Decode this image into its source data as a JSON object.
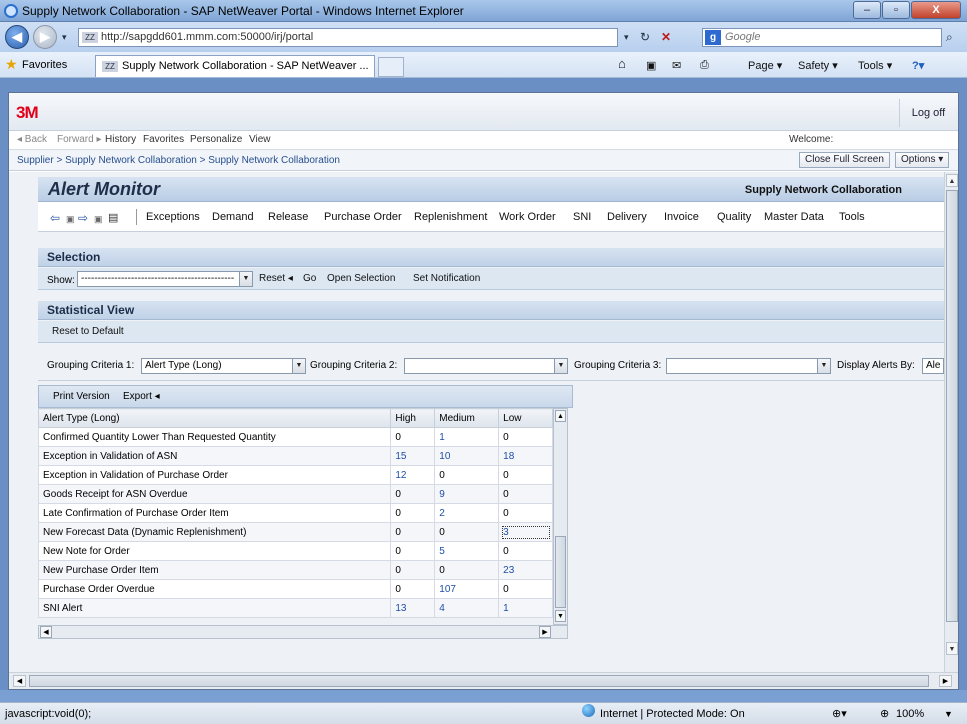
{
  "window": {
    "title": "Supply Network Collaboration - SAP NetWeaver Portal - Windows Internet Explorer",
    "minimize": "–",
    "maximize": "▫",
    "close": "X"
  },
  "address": {
    "url": "http://sapgdd601.mmm.com:50000/irj/portal",
    "search_placeholder": "Google"
  },
  "favorites_bar": {
    "favorites_label": "Favorites",
    "tab_label": "Supply Network Collaboration - SAP NetWeaver ...",
    "page_menu": "Page ▾",
    "safety_menu": "Safety ▾",
    "tools_menu": "Tools ▾"
  },
  "portal": {
    "logo": "3M",
    "logoff": "Log off",
    "nav": {
      "back": "◂ Back",
      "forward": "Forward ▸",
      "history": "History",
      "favorites": "Favorites",
      "personalize": "Personalize",
      "view": "View",
      "welcome": "Welcome:"
    },
    "breadcrumb": "Supplier  >  Supply Network Collaboration  >  Supply Network Collaboration",
    "close_full_screen": "Close Full Screen",
    "options": "Options ▾"
  },
  "app": {
    "title": "Alert Monitor",
    "subtitle": "Supply Network Collaboration",
    "menu": [
      "Exceptions",
      "Demand",
      "Release",
      "Purchase Order",
      "Replenishment",
      "Work Order",
      "SNI",
      "Delivery",
      "Invoice",
      "Quality",
      "Master Data",
      "Tools"
    ]
  },
  "selection": {
    "heading": "Selection",
    "show_label": "Show:",
    "show_value": "----------------------------------------------",
    "reset": "Reset ◂",
    "go": "Go",
    "open_selection": "Open Selection",
    "set_notification": "Set Notification"
  },
  "statistical": {
    "heading": "Statistical View",
    "reset_default": "Reset to Default",
    "criteria1_label": "Grouping Criteria 1:",
    "criteria1_value": "Alert Type (Long)",
    "criteria2_label": "Grouping Criteria 2:",
    "criteria2_value": "",
    "criteria3_label": "Grouping Criteria 3:",
    "criteria3_value": "",
    "display_label": "Display Alerts By:",
    "display_value": "Ale",
    "print_version": "Print Version",
    "export": "Export ◂"
  },
  "table": {
    "headers": [
      "Alert Type (Long)",
      "High",
      "Medium",
      "Low"
    ],
    "rows": [
      [
        "Confirmed Quantity Lower Than Requested Quantity",
        "0",
        "1",
        "0"
      ],
      [
        "Exception in Validation of ASN",
        "15",
        "10",
        "18"
      ],
      [
        "Exception in Validation of Purchase Order",
        "12",
        "0",
        "0"
      ],
      [
        "Goods Receipt for ASN Overdue",
        "0",
        "9",
        "0"
      ],
      [
        "Late Confirmation of Purchase Order Item",
        "0",
        "2",
        "0"
      ],
      [
        "New Forecast Data (Dynamic Replenishment)",
        "0",
        "0",
        "3"
      ],
      [
        "New Note for Order",
        "0",
        "5",
        "0"
      ],
      [
        "New Purchase Order Item",
        "0",
        "0",
        "23"
      ],
      [
        "Purchase Order Overdue",
        "0",
        "107",
        "0"
      ],
      [
        "SNI Alert",
        "13",
        "4",
        "1"
      ]
    ]
  },
  "status": {
    "left": "javascript:void(0);",
    "zone": "Internet | Protected Mode: On",
    "zoom": "100%"
  },
  "colors": {
    "link_blue": "#1f4fa5",
    "header_blue": "#c0d2e8",
    "brand_red": "#e2001a"
  }
}
